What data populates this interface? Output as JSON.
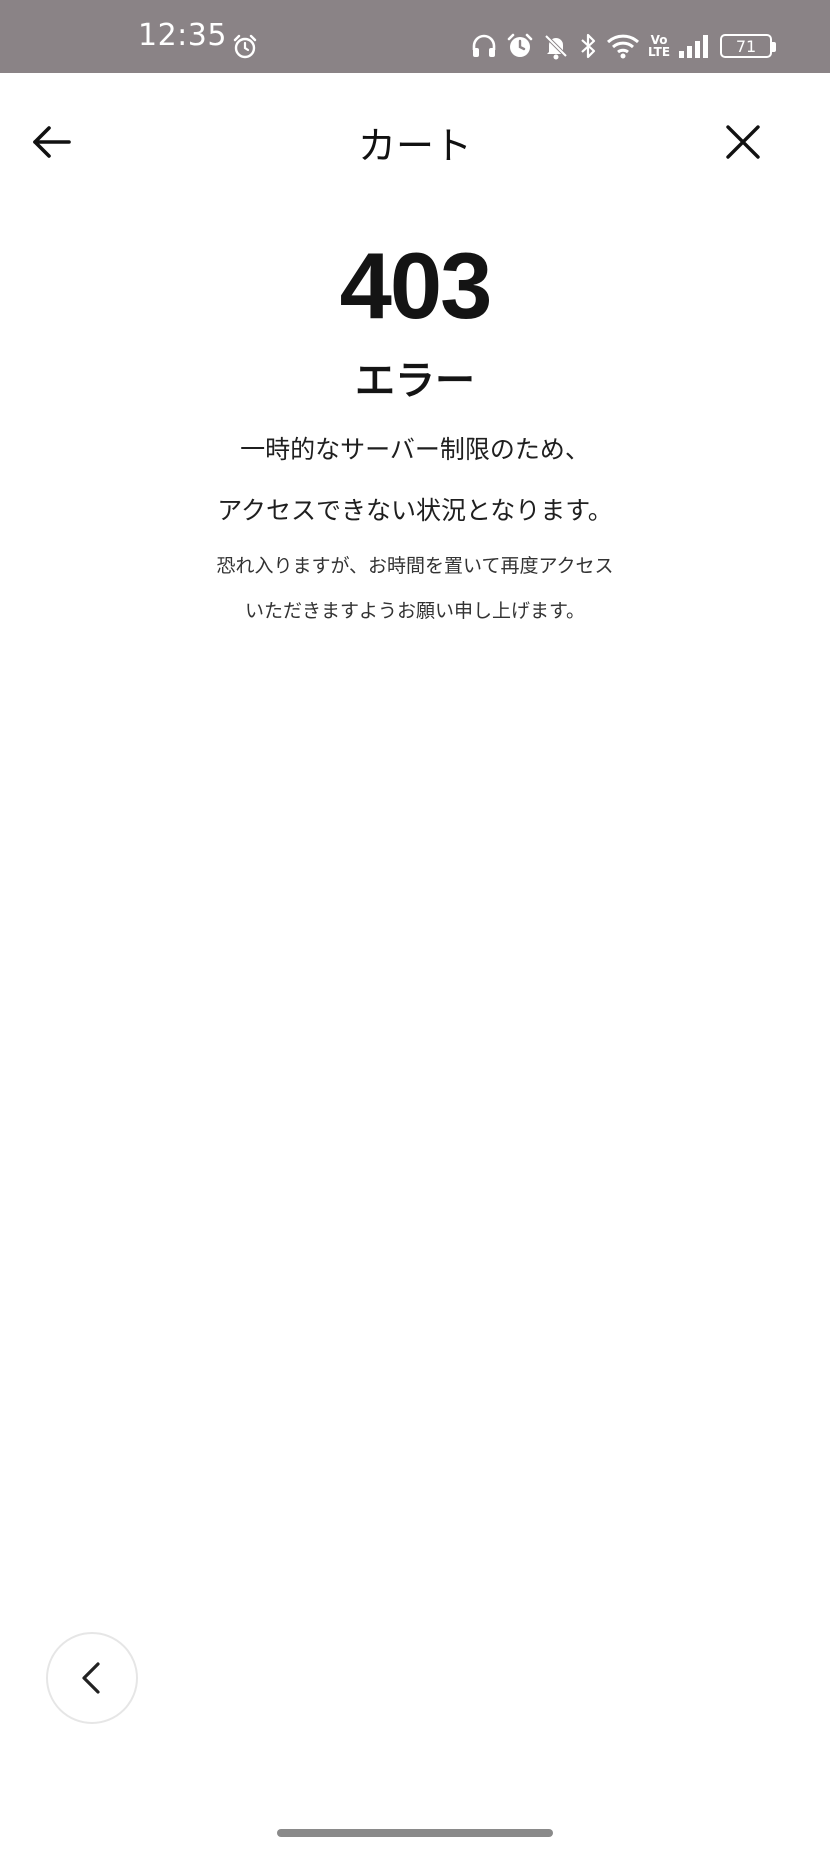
{
  "status_bar": {
    "time": "12:35",
    "volte_top": "Vo",
    "volte_bottom": "LTE",
    "battery": "71",
    "icons": [
      "alarm-icon",
      "headphones-icon",
      "alarm-icon",
      "bell-muted-icon",
      "bluetooth-icon",
      "wifi-icon",
      "volte-icon",
      "signal-icon",
      "battery-icon"
    ],
    "background": "#8a8386"
  },
  "header": {
    "title": "カート",
    "back_icon": "arrow-left-icon",
    "close_icon": "close-icon"
  },
  "error": {
    "code": "403",
    "title": "エラー",
    "message_line1": "一時的なサーバー制限のため、",
    "message_line2": "アクセスできない状況となります。",
    "note_line1": "恐れ入りますが、お時間を置いて再度アクセス",
    "note_line2": "いただきますようお願い申し上げます。"
  },
  "floating_button": {
    "icon": "chevron-left-icon"
  }
}
